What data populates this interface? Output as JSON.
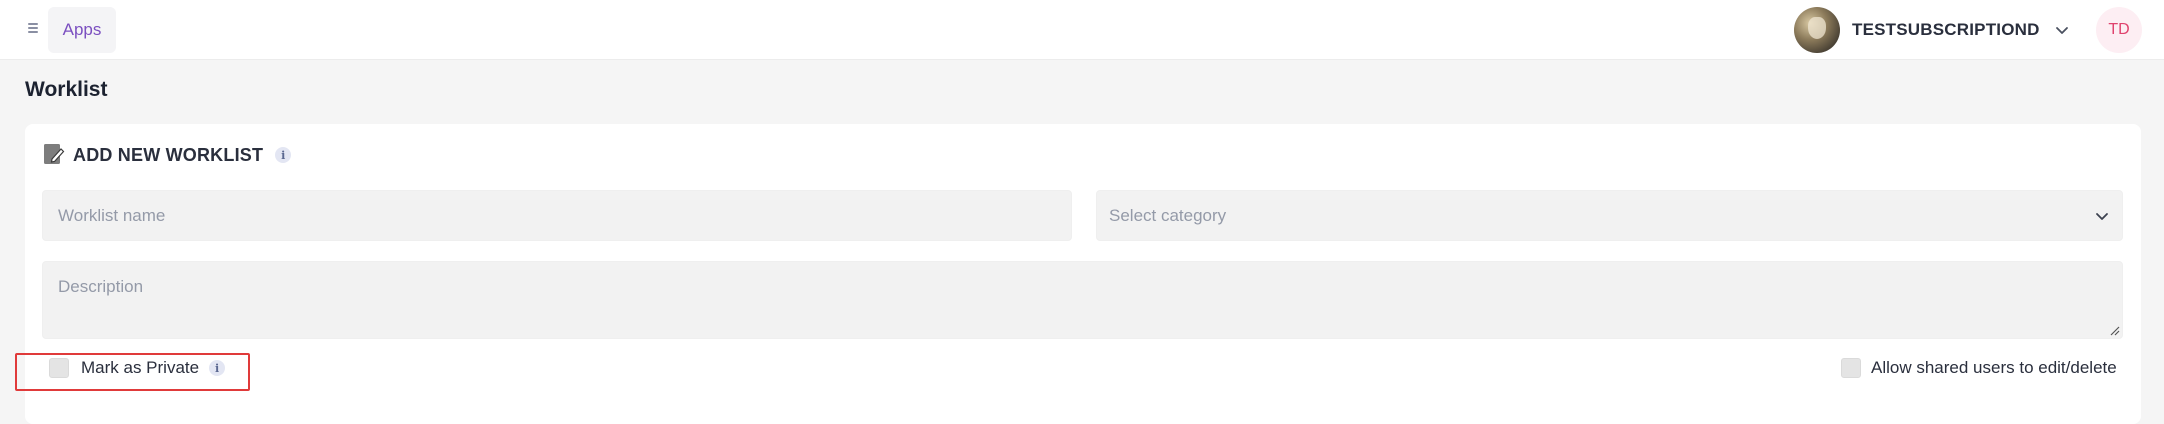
{
  "topbar": {
    "menu_icon": "hamburger-icon",
    "apps_label": "Apps",
    "org_name": "TESTSUBSCRIPTIOND",
    "user_initials": "TD"
  },
  "page": {
    "title": "Worklist"
  },
  "card": {
    "title": "ADD NEW WORKLIST",
    "title_icon": "edit-icon",
    "info_glyph": "i",
    "name_placeholder": "Worklist name",
    "category_placeholder": "Select category",
    "description_placeholder": "Description",
    "private_label": "Mark as Private",
    "private_checked": false,
    "shared_label": "Allow shared users to edit/delete",
    "shared_checked": false
  },
  "colors": {
    "accent_purple": "#7b4fc0",
    "avatar_pink": "#e0436e",
    "highlight_red": "#e03a3a"
  }
}
